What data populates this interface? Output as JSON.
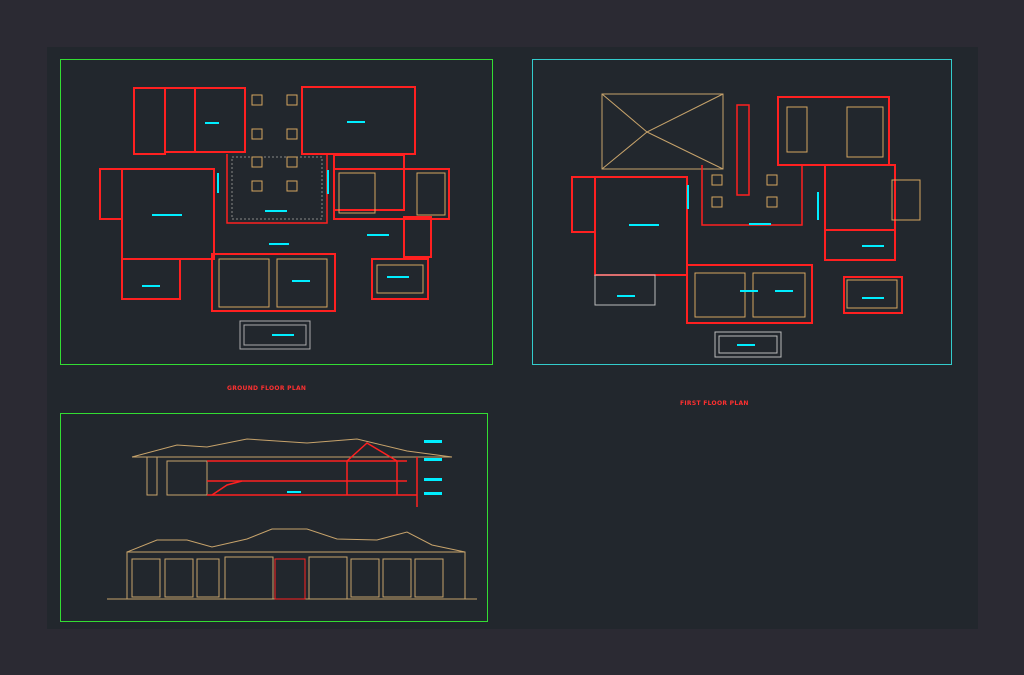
{
  "drawing": {
    "background_color": "#22272d",
    "outer_color": "#2b2a33",
    "frame_green": "#33dd33",
    "frame_cyan": "#33cccc",
    "wall_color": "#ff2020",
    "accent_cyan": "#00eeff",
    "furniture_color": "#d4a560",
    "roof_color": "#c7a36b"
  },
  "sheets": {
    "ground_floor_title": "GROUND FLOOR PLAN",
    "first_floor_title": "FIRST FLOOR PLAN"
  }
}
